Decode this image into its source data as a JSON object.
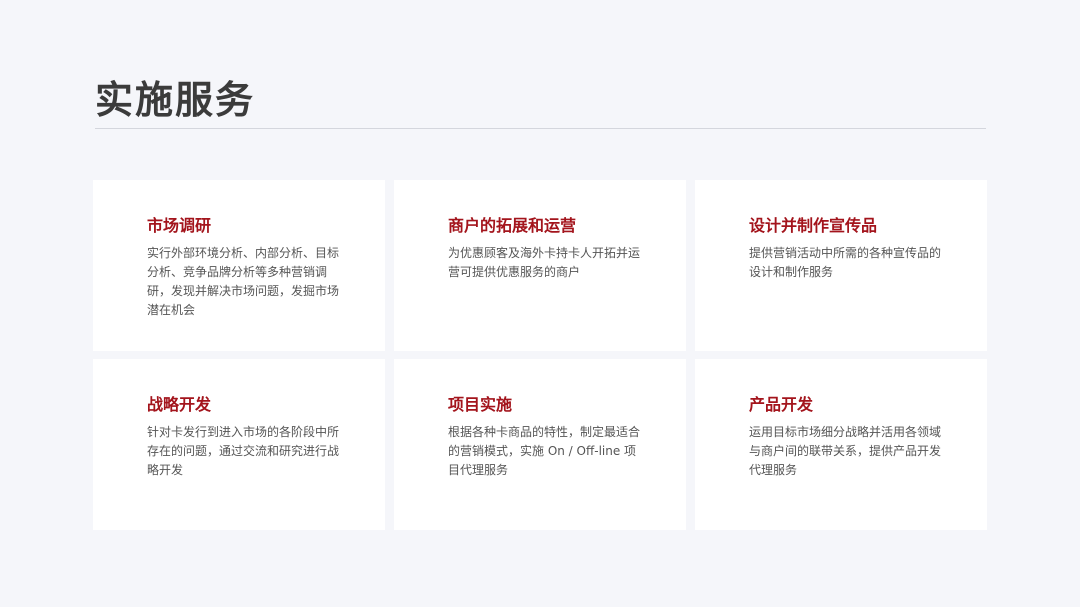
{
  "page": {
    "title": "实施服务"
  },
  "cards": [
    {
      "title": "市场调研",
      "desc": "实行外部环境分析、内部分析、目标分析、竞争品牌分析等多种营销调研，发现并解决市场问题，发掘市场潜在机会"
    },
    {
      "title": "商户的拓展和运营",
      "desc": "为优惠顾客及海外卡持卡人开拓并运营可提供优惠服务的商户"
    },
    {
      "title": "设计并制作宣传品",
      "desc": "提供营销活动中所需的各种宣传品的设计和制作服务"
    },
    {
      "title": "战略开发",
      "desc": "针对卡发行到进入市场的各阶段中所存在的问题，通过交流和研究进行战略开发"
    },
    {
      "title": "项目实施",
      "desc": "根据各种卡商品的特性，制定最适合的营销模式，实施 On / Off-line 项目代理服务"
    },
    {
      "title": "产品开发",
      "desc": "运用目标市场细分战略并活用各领域与商户间的联带关系，提供产品开发代理服务"
    }
  ]
}
